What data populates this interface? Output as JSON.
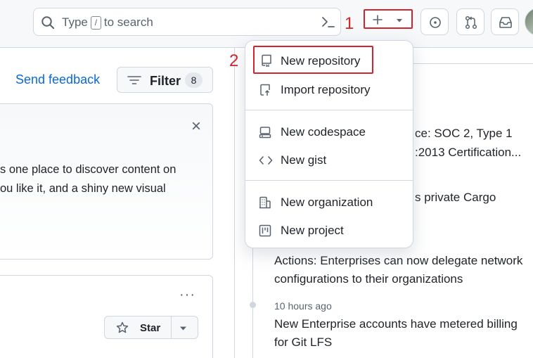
{
  "header": {
    "search": {
      "prefix": "Type",
      "key": "/",
      "suffix": "to search"
    },
    "step1": "1",
    "step2": "2"
  },
  "left": {
    "send_feedback": "Send feedback",
    "filter": {
      "label": "Filter",
      "count": "8"
    },
    "card_close": "×",
    "card_lines": [
      "s one place to discover content on",
      "ou like it, and a shiny new visual"
    ],
    "more": "···",
    "star_label": "Star"
  },
  "right": {
    "lines": [
      "ce: SOC 2, Type 1",
      ":2013 Certification...",
      "s private Cargo",
      "Actions: Enterprises can now delegate network",
      "configurations to their organizations",
      "New Enterprise accounts have metered billing",
      "for Git LFS"
    ],
    "time": "10 hours ago"
  },
  "menu": {
    "items": [
      {
        "label": "New repository",
        "icon": "repo-icon"
      },
      {
        "label": "Import repository",
        "icon": "repo-push-icon"
      },
      {
        "label": "New codespace",
        "icon": "codespaces-icon"
      },
      {
        "label": "New gist",
        "icon": "code-icon"
      },
      {
        "label": "New organization",
        "icon": "organization-icon"
      },
      {
        "label": "New project",
        "icon": "project-icon"
      }
    ]
  },
  "colors": {
    "annotation": "#d1242f",
    "link": "#0969da",
    "border": "#d0d7de"
  }
}
